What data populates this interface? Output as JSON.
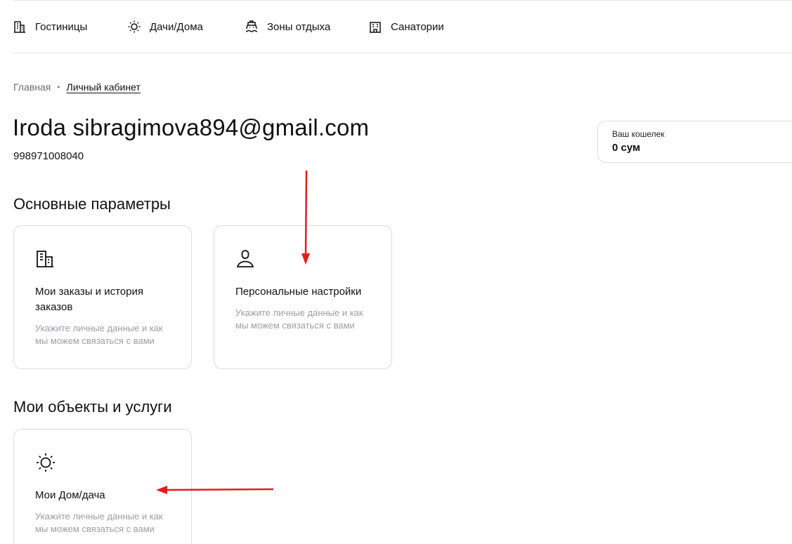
{
  "nav": {
    "items": [
      {
        "label": "Гостиницы",
        "icon": "building-icon"
      },
      {
        "label": "Дачи/Дома",
        "icon": "sun-icon"
      },
      {
        "label": "Зоны отдыха",
        "icon": "boat-icon"
      },
      {
        "label": "Санатории",
        "icon": "sanatorium-icon"
      }
    ]
  },
  "breadcrumb": {
    "home": "Главная",
    "separator": "•",
    "current": "Личный кабинет"
  },
  "user": {
    "name": "Iroda sibragimova894@gmail.com",
    "phone": "998971008040"
  },
  "wallet": {
    "title": "Ваш кошелек",
    "value": "0 сум"
  },
  "sections": {
    "main_params": {
      "title": "Основные параметры",
      "cards": [
        {
          "title": "Мои заказы и история заказов",
          "description": "Укажите личные данные и как мы можем связаться с вами",
          "icon": "building-icon"
        },
        {
          "title": "Персональные настройки",
          "description": "Укажите личные данные и как мы можем связаться с вами",
          "icon": "user-icon"
        }
      ]
    },
    "objects": {
      "title": "Мои объекты и услуги",
      "cards": [
        {
          "title": "Мои Дом/дача",
          "description": "Укажите личные данные и как мы можем связаться с вами",
          "icon": "sun-icon"
        }
      ]
    }
  },
  "annotations": {
    "arrow_color": "#e01e1e"
  },
  "colors": {
    "text": "#111111",
    "muted": "#9a9ea8",
    "border": "#dcdcdc"
  }
}
